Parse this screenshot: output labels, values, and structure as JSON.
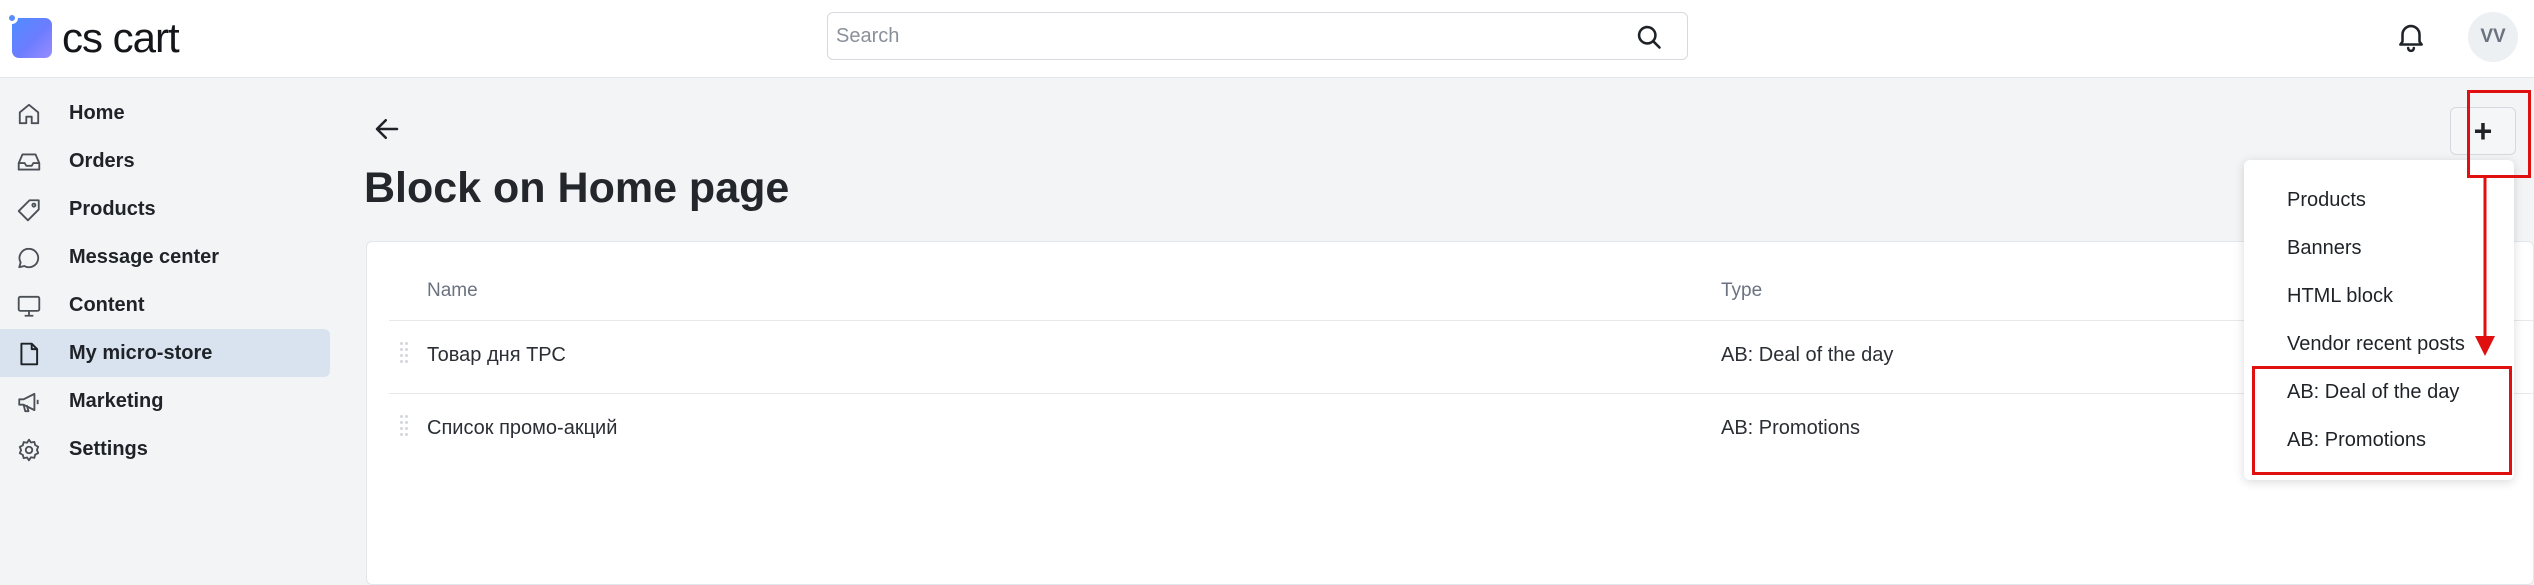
{
  "header": {
    "logo_text": "cs cart",
    "search": {
      "placeholder": "Search",
      "value": ""
    },
    "avatar_initials": "VV"
  },
  "sidebar": {
    "items": [
      {
        "label": "Home",
        "icon": "home-icon",
        "active": false
      },
      {
        "label": "Orders",
        "icon": "inbox-icon",
        "active": false
      },
      {
        "label": "Products",
        "icon": "tag-icon",
        "active": false
      },
      {
        "label": "Message center",
        "icon": "chat-icon",
        "active": false
      },
      {
        "label": "Content",
        "icon": "monitor-icon",
        "active": false
      },
      {
        "label": "My micro-store",
        "icon": "file-icon",
        "active": true
      },
      {
        "label": "Marketing",
        "icon": "megaphone-icon",
        "active": false
      },
      {
        "label": "Settings",
        "icon": "gear-icon",
        "active": false
      }
    ]
  },
  "main": {
    "title": "Block on Home page",
    "table": {
      "columns": [
        "Name",
        "Type"
      ],
      "rows": [
        {
          "name": "Товар дня ТРС",
          "type": "AB: Deal of the day"
        },
        {
          "name": "Список промо-акций",
          "type": "AB: Promotions"
        }
      ]
    },
    "add_button_label": "+"
  },
  "dropdown": {
    "items": [
      "Products",
      "Banners",
      "HTML block",
      "Vendor recent posts",
      "AB: Deal of the day",
      "AB: Promotions"
    ]
  },
  "colors": {
    "annotation": "#e01010",
    "active_nav": "#d9e3ef",
    "brand": "#5a8dff"
  }
}
